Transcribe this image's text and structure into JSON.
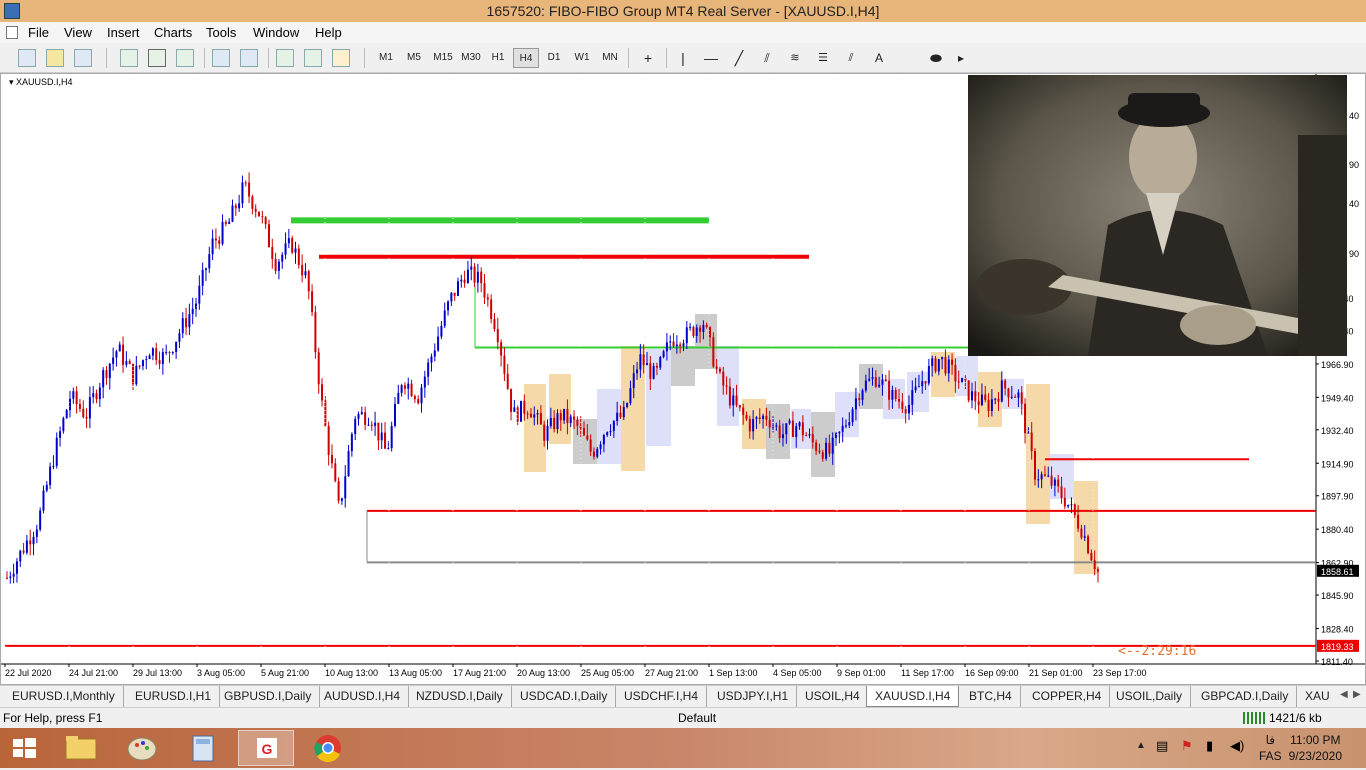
{
  "window": {
    "title": "1657520: FIBO-FIBO Group MT4 Real Server - [XAUUSD.I,H4]"
  },
  "menu": [
    "File",
    "View",
    "Insert",
    "Charts",
    "Tools",
    "Window",
    "Help"
  ],
  "toolbar": {
    "timeframes": [
      "M1",
      "M5",
      "M15",
      "M30",
      "H1",
      "H4",
      "D1",
      "W1",
      "MN"
    ],
    "selected_timeframe": "H4",
    "text_tool": "A"
  },
  "chart": {
    "symbol_label": "XAUUSD.I,H4",
    "current_price": "1858.61",
    "alert_price": "1819.33",
    "countdown": "<--2:29:16",
    "price_ticks": [
      "2001.40",
      "1984.40",
      "1966.90",
      "1949.40",
      "1932.40",
      "1914.90",
      "1897.90",
      "1880.40",
      "1862.90",
      "1845.90",
      "1828.40",
      "1811.40"
    ],
    "partial_ticks": [
      "40",
      "90",
      "40",
      "90"
    ],
    "time_ticks": [
      "22 Jul 2020",
      "24 Jul 21:00",
      "29 Jul 13:00",
      "3 Aug 05:00",
      "5 Aug 21:00",
      "10 Aug 13:00",
      "13 Aug 05:00",
      "17 Aug 21:00",
      "20 Aug 13:00",
      "25 Aug 05:00",
      "27 Aug 21:00",
      "1 Sep 13:00",
      "4 Sep 05:00",
      "9 Sep 01:00",
      "11 Sep 17:00",
      "16 Sep 09:00",
      "21 Sep 01:00",
      "23 Sep 17:00"
    ],
    "colors": {
      "bull": "#0000cc",
      "bear": "#cc0000",
      "green_line": "#33cc33",
      "red_line": "#ee0000",
      "box_orange": "#f5d9a8",
      "box_blue": "#dde0f8",
      "box_gray": "#cccccc"
    }
  },
  "chart_data": {
    "type": "candlestick",
    "symbol": "XAUUSD.I",
    "timeframe": "H4",
    "ylim": [
      1811.4,
      2050
    ],
    "current_price": 1858.61,
    "horizontal_levels": [
      {
        "price": 2042,
        "color": "green"
      },
      {
        "price": 2023,
        "color": "red"
      },
      {
        "price": 1975.5,
        "color": "green"
      },
      {
        "price": 1917,
        "color": "red"
      },
      {
        "price": 1890,
        "color": "red"
      },
      {
        "price": 1863,
        "color": "gray"
      },
      {
        "price": 1819.33,
        "color": "red"
      }
    ],
    "close_path": [
      1855,
      1870,
      1885,
      1920,
      1950,
      1940,
      1960,
      1975,
      1960,
      1975,
      1970,
      1985,
      2000,
      2030,
      2040,
      2060,
      2045,
      2020,
      2030,
      2010,
      1940,
      1890,
      1940,
      1940,
      1920,
      1960,
      1950,
      1975,
      2000,
      2015,
      2010,
      1985,
      1940,
      1945,
      1930,
      1940,
      1935,
      1920,
      1935,
      1940,
      1970,
      1960,
      1980,
      1982,
      1990,
      1960,
      1945,
      1935,
      1940,
      1930,
      1935,
      1925,
      1920,
      1935,
      1955,
      1960,
      1950,
      1945,
      1960,
      1970,
      1960,
      1950,
      1945,
      1955,
      1950,
      1910,
      1905,
      1895,
      1880,
      1858
    ]
  },
  "tabs": [
    "EURUSD.I,Monthly",
    "EURUSD.I,H1",
    "GBPUSD.I,Daily",
    "AUDUSD.I,H4",
    "NZDUSD.I,Daily",
    "USDCAD.I,Daily",
    "USDCHF.I,H4",
    "USDJPY.I,H1",
    "USOIL,H4",
    "XAUUSD.I,H4",
    "BTC,H4",
    "COPPER,H4",
    "USOIL,Daily",
    "GBPCAD.I,Daily",
    "XAU"
  ],
  "active_tab": "XAUUSD.I,H4",
  "status": {
    "help": "For Help, press F1",
    "profile": "Default",
    "traffic": "1421/6 kb"
  },
  "taskbar": {
    "time": "11:00 PM",
    "date": "9/23/2020",
    "lang": "FAS",
    "lang_char": "فا"
  }
}
